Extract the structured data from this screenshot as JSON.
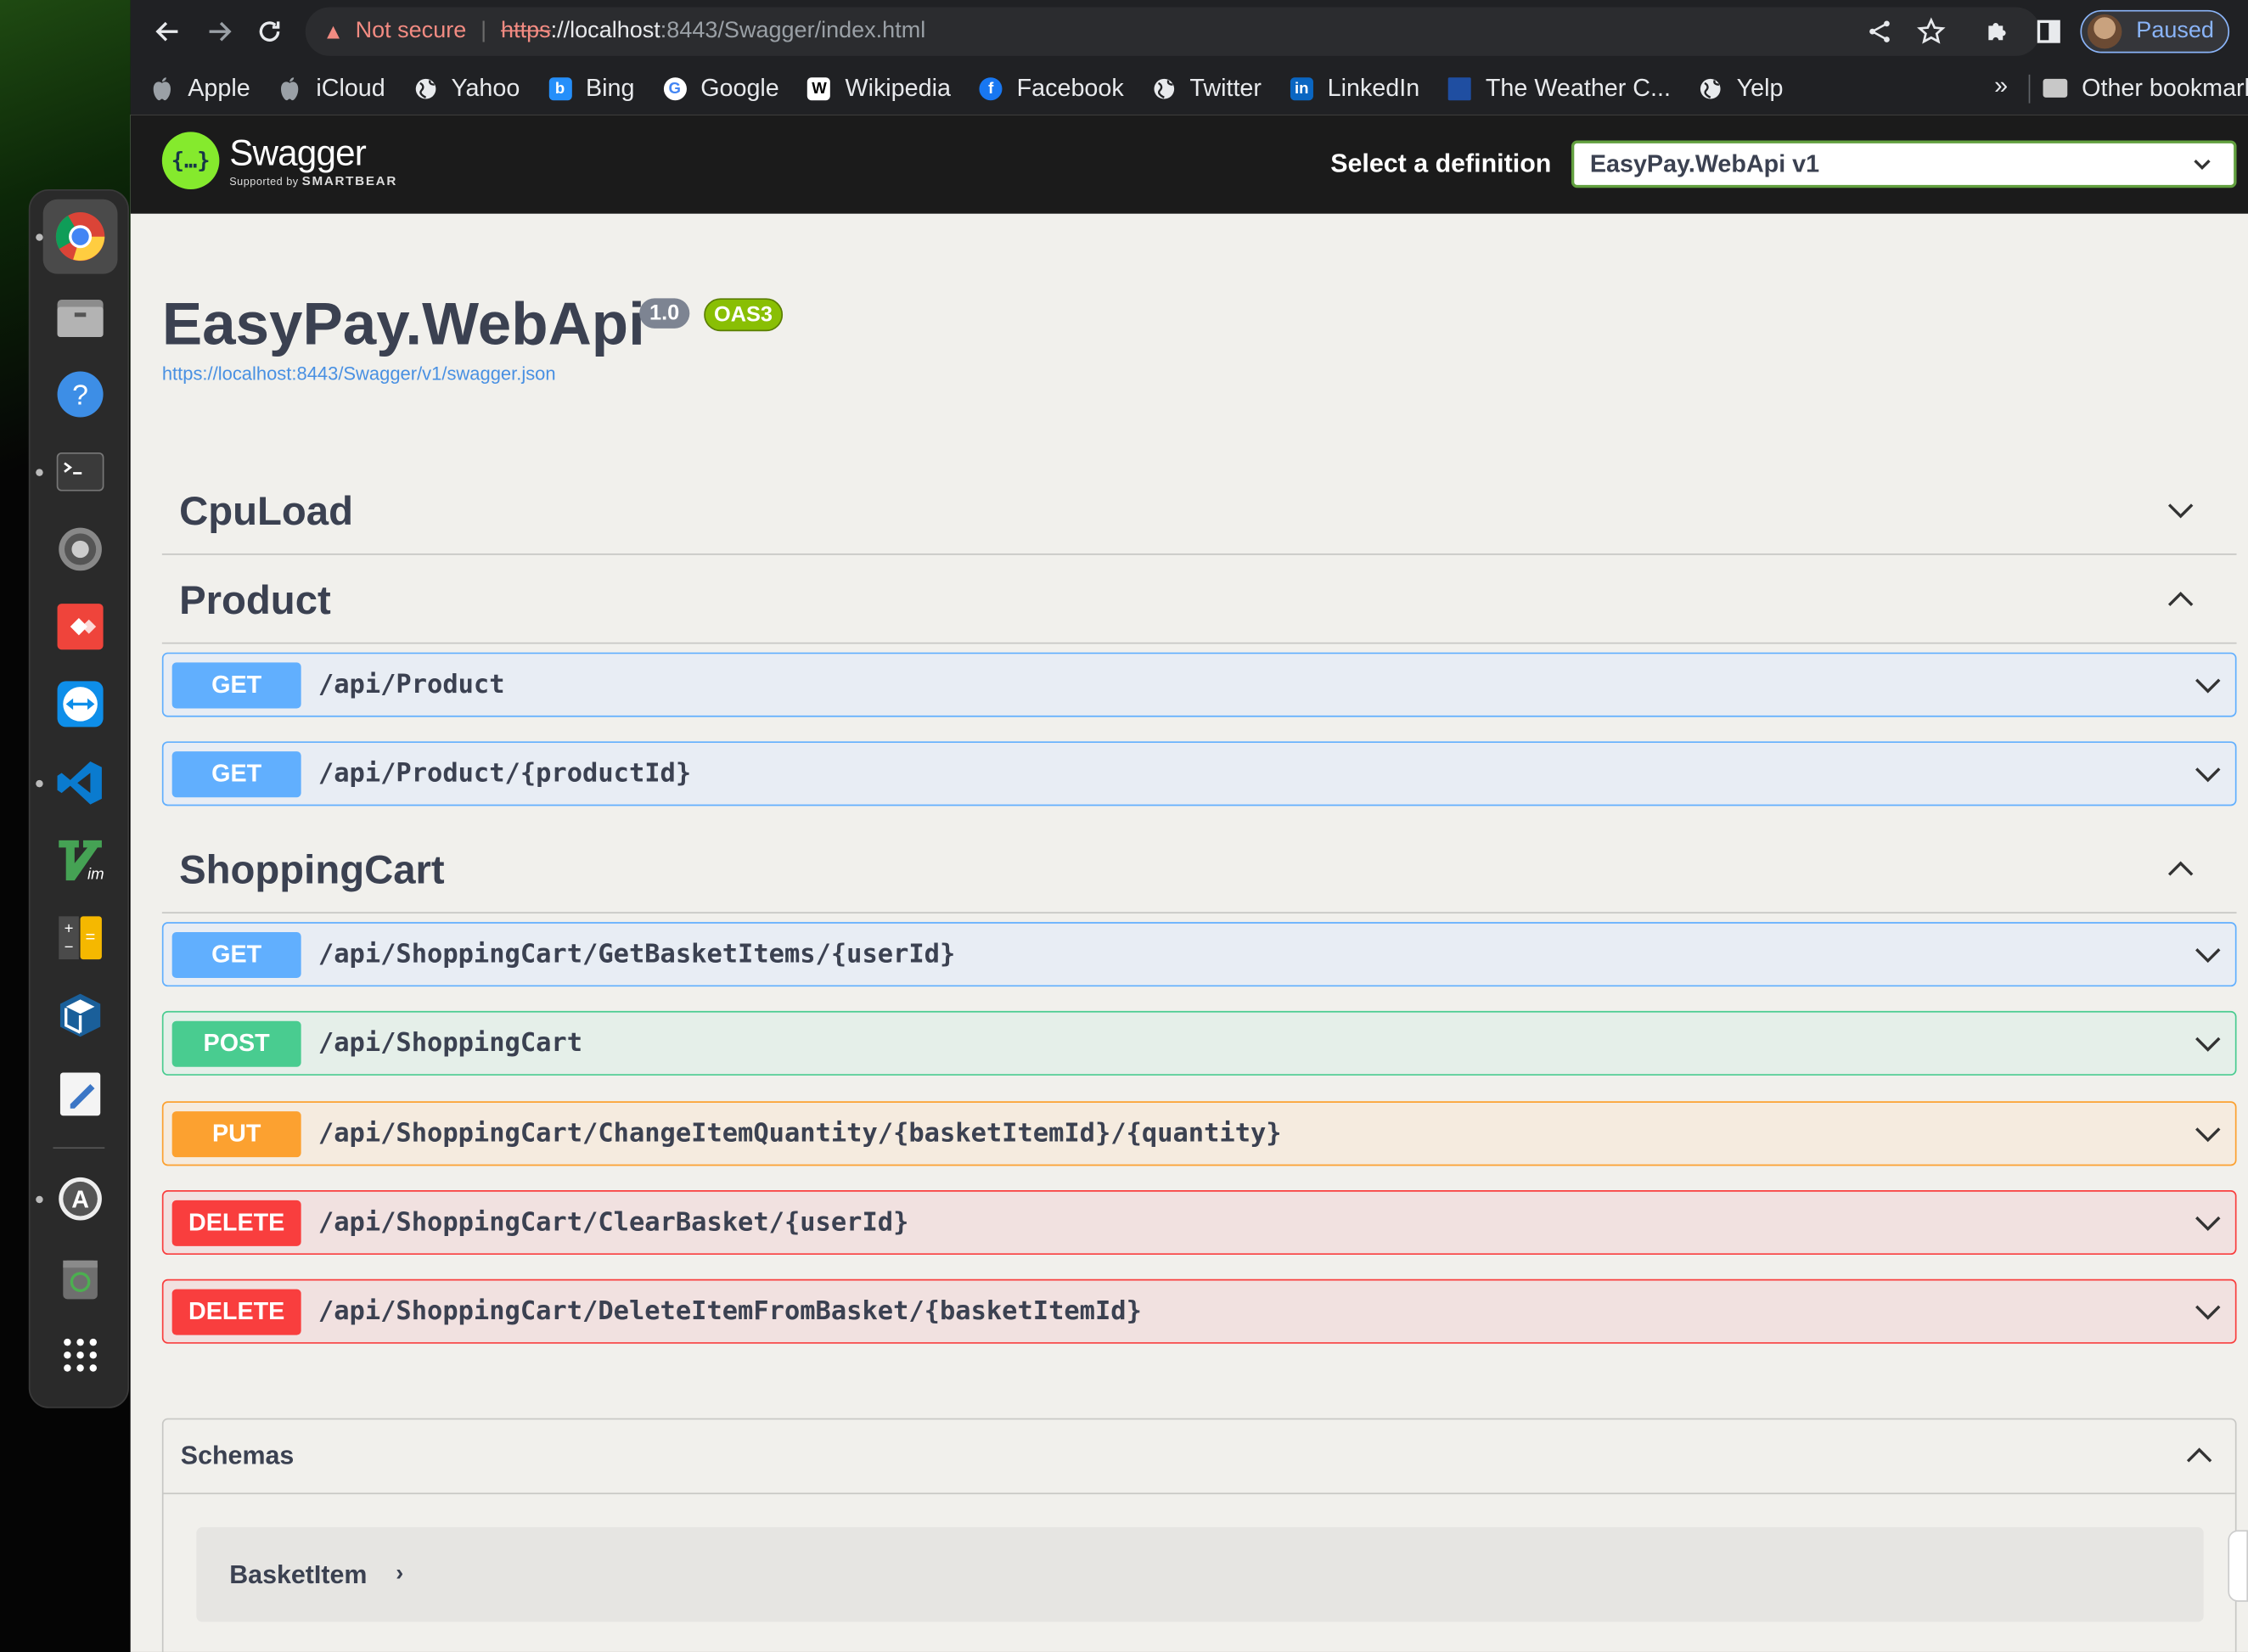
{
  "browser": {
    "security_warning": "Not secure",
    "url_scheme": "https",
    "url_host": "://localhost",
    "url_path": ":8443/Swagger/index.html",
    "profile_status": "Paused",
    "bookmarks": [
      {
        "label": "Apple",
        "icon": "apple-icon",
        "color": "#9aa0a6",
        "glyph": ""
      },
      {
        "label": "iCloud",
        "icon": "apple-icon",
        "color": "#9aa0a6",
        "glyph": ""
      },
      {
        "label": "Yahoo",
        "icon": "globe-icon",
        "color": "#e8eaed",
        "glyph": ""
      },
      {
        "label": "Bing",
        "icon": "bing-icon",
        "color": "#258ffa",
        "glyph": "b"
      },
      {
        "label": "Google",
        "icon": "google-icon",
        "color": "#ffffff",
        "glyph": "G"
      },
      {
        "label": "Wikipedia",
        "icon": "wikipedia-icon",
        "color": "#ffffff",
        "glyph": "W"
      },
      {
        "label": "Facebook",
        "icon": "facebook-icon",
        "color": "#1877f2",
        "glyph": "f"
      },
      {
        "label": "Twitter",
        "icon": "globe-icon",
        "color": "#e8eaed",
        "glyph": ""
      },
      {
        "label": "LinkedIn",
        "icon": "linkedin-icon",
        "color": "#0a66c2",
        "glyph": "in"
      },
      {
        "label": "The Weather C...",
        "icon": "weather-channel-icon",
        "color": "#1f4ea1",
        "glyph": ""
      },
      {
        "label": "Yelp",
        "icon": "globe-icon",
        "color": "#e8eaed",
        "glyph": ""
      }
    ],
    "overflow": "»",
    "other_bookmarks": "Other bookmarks"
  },
  "dock": [
    {
      "name": "chrome-icon",
      "active": true,
      "dot": true
    },
    {
      "name": "files-icon",
      "active": false,
      "dot": false
    },
    {
      "name": "help-icon",
      "active": false,
      "dot": false
    },
    {
      "name": "terminal-icon",
      "active": false,
      "dot": true
    },
    {
      "name": "settings-icon",
      "active": false,
      "dot": false
    },
    {
      "name": "anydesk-icon",
      "active": false,
      "dot": false
    },
    {
      "name": "teamviewer-icon",
      "active": false,
      "dot": false
    },
    {
      "name": "vscode-icon",
      "active": false,
      "dot": true
    },
    {
      "name": "vim-icon",
      "active": false,
      "dot": false
    },
    {
      "name": "calculator-icon",
      "active": false,
      "dot": false
    },
    {
      "name": "virtualbox-icon",
      "active": false,
      "dot": false
    },
    {
      "name": "text-editor-icon",
      "active": false,
      "dot": false
    },
    {
      "name": "software-updater-icon",
      "active": false,
      "dot": true
    },
    {
      "name": "trash-icon",
      "active": false,
      "dot": false
    },
    {
      "name": "app-grid-icon",
      "active": false,
      "dot": false
    }
  ],
  "swagger": {
    "logo_name": "Swagger",
    "logo_sub_prefix": "Supported by",
    "logo_sub_brand": "SMARTBEAR",
    "select_label": "Select a definition",
    "selected_definition": "EasyPay.WebApi v1",
    "title": "EasyPay.WebApi",
    "version": "1.0",
    "oas": "OAS3",
    "spec_url": "https://localhost:8443/Swagger/v1/swagger.json",
    "tags": [
      {
        "name": "CpuLoad",
        "expanded": false
      },
      {
        "name": "Product",
        "expanded": true
      },
      {
        "name": "ShoppingCart",
        "expanded": true
      }
    ],
    "operations": [
      {
        "method": "GET",
        "path": "/api/Product",
        "tag": "Product"
      },
      {
        "method": "GET",
        "path": "/api/Product/{productId}",
        "tag": "Product"
      },
      {
        "method": "GET",
        "path": "/api/ShoppingCart/GetBasketItems/{userId}",
        "tag": "ShoppingCart"
      },
      {
        "method": "POST",
        "path": "/api/ShoppingCart",
        "tag": "ShoppingCart"
      },
      {
        "method": "PUT",
        "path": "/api/ShoppingCart/ChangeItemQuantity/{basketItemId}/{quantity}",
        "tag": "ShoppingCart"
      },
      {
        "method": "DELETE",
        "path": "/api/ShoppingCart/ClearBasket/{userId}",
        "tag": "ShoppingCart"
      },
      {
        "method": "DELETE",
        "path": "/api/ShoppingCart/DeleteItemFromBasket/{basketItemId}",
        "tag": "ShoppingCart"
      }
    ],
    "schemas_title": "Schemas",
    "schemas": [
      "BasketItem"
    ]
  },
  "colors": {
    "get": "#61affe",
    "post": "#49cc90",
    "put": "#fca130",
    "delete": "#f93e3e",
    "swagger_green": "#85ea2d"
  }
}
